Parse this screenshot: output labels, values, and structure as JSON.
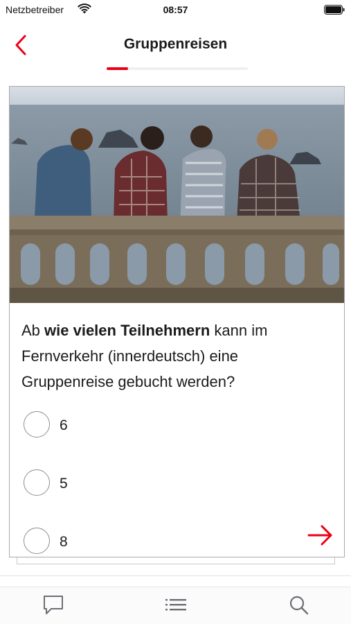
{
  "status_bar": {
    "carrier": "Netzbetreiber",
    "time": "08:57"
  },
  "nav": {
    "title": "Gruppenreisen",
    "progress_fraction": 0.15
  },
  "question": {
    "prefix": "Ab ",
    "bold": "wie vielen Teilnehmern",
    "suffix": " kann im Fernverkehr (innerdeutsch) eine Gruppenreise gebucht werden?"
  },
  "answers": [
    {
      "label": "6"
    },
    {
      "label": "5"
    },
    {
      "label": "8"
    }
  ],
  "icons": {
    "back": "chevron-left-icon",
    "next": "arrow-right-icon",
    "tabs": [
      "chat-bubble-icon",
      "list-icon",
      "search-icon"
    ]
  },
  "colors": {
    "accent": "#ec0016",
    "text": "#1b1b1b",
    "icon_gray": "#6b6e74"
  }
}
